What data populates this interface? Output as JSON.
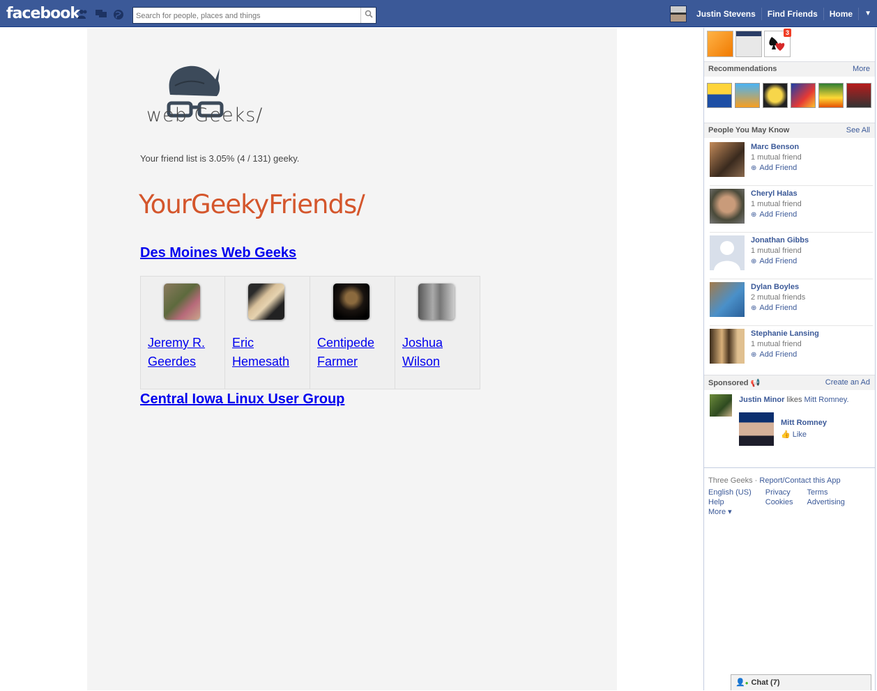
{
  "topbar": {
    "logo": "facebook",
    "search_placeholder": "Search for people, places and things",
    "user_name": "Justin Stevens",
    "nav_find_friends": "Find Friends",
    "nav_home": "Home",
    "dropdown_glyph": "▼"
  },
  "app": {
    "logo_text": "web Geeks/",
    "stat_text": "Your friend list is 3.05% (4 / 131) geeky.",
    "title": "YourGeekyFriends/",
    "groups": [
      {
        "name": "Des Moines Web Geeks",
        "friends": [
          {
            "first": "Jeremy R.",
            "last": "Geerdes"
          },
          {
            "first": "Eric",
            "last": "Hemesath"
          },
          {
            "first": "Centipede",
            "last": "Farmer"
          },
          {
            "first": "Joshua",
            "last": "Wilson"
          }
        ]
      },
      {
        "name": "Central Iowa Linux User Group"
      }
    ]
  },
  "sidebar": {
    "app_badge": "3",
    "recommendations": {
      "title": "Recommendations",
      "action": "More"
    },
    "pymk": {
      "title": "People You May Know",
      "action": "See All",
      "people": [
        {
          "name": "Marc Benson",
          "mutual": "1 mutual friend",
          "add": "Add Friend"
        },
        {
          "name": "Cheryl Halas",
          "mutual": "1 mutual friend",
          "add": "Add Friend"
        },
        {
          "name": "Jonathan Gibbs",
          "mutual": "1 mutual friend",
          "add": "Add Friend"
        },
        {
          "name": "Dylan Boyles",
          "mutual": "2 mutual friends",
          "add": "Add Friend"
        },
        {
          "name": "Stephanie Lansing",
          "mutual": "1 mutual friend",
          "add": "Add Friend"
        }
      ]
    },
    "sponsored": {
      "title": "Sponsored",
      "action": "Create an Ad",
      "actor": "Justin Minor",
      "verb": "likes",
      "object": "Mitt Romney.",
      "page_name": "Mitt Romney",
      "like": "Like"
    },
    "footer": {
      "app_name": "Three Geeks",
      "separator": "·",
      "report": "Report/Contact this App",
      "col1": [
        "English (US)",
        "Help",
        "More ▾"
      ],
      "col2": [
        "Privacy",
        "Cookies"
      ],
      "col3": [
        "Terms",
        "Advertising"
      ]
    }
  },
  "chat": {
    "label": "Chat (7)"
  }
}
